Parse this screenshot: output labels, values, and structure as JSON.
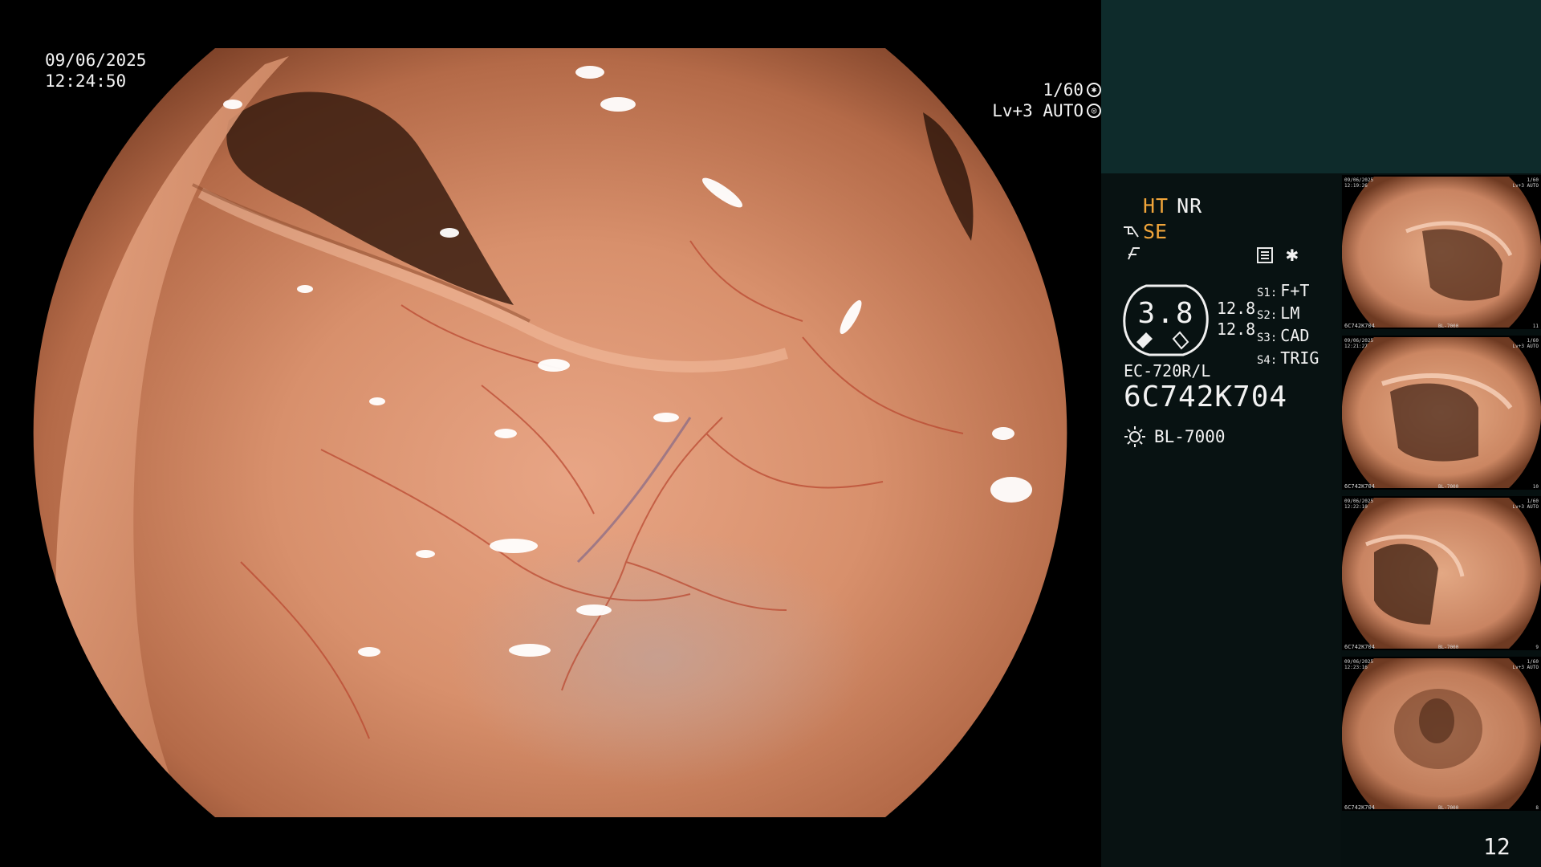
{
  "overlay": {
    "date": "09/06/2025",
    "time": "12:24:50",
    "shutter": "1/60",
    "level": "Lv+3 AUTO"
  },
  "panel": {
    "mode_ht": "HT",
    "mode_nr": "NR",
    "mode_se": "SE",
    "zoom": "3.8",
    "zoom_a": "12.8",
    "zoom_b": "12.8",
    "switches": [
      {
        "key": "S1:",
        "value": "F+T"
      },
      {
        "key": "S2:",
        "value": "LM"
      },
      {
        "key": "S3:",
        "value": "CAD"
      },
      {
        "key": "S4:",
        "value": "TRIG"
      }
    ],
    "scope_model": "EC-720R/L",
    "scope_serial": "6C742K704",
    "light_source": "BL-7000",
    "colors": {
      "accent_orange": "#f1a53a",
      "panel_top": "#0e2b2b",
      "panel_bg": "#081212"
    },
    "icons": [
      "scope-angle-icon",
      "freeze-icon",
      "settings-icon",
      "star-icon",
      "light-source-icon",
      "shutter-icon",
      "auto-iris-icon"
    ]
  },
  "thumbnails": [
    {
      "date": "09/06/2025",
      "time": "12:19:26",
      "shutter": "1/60",
      "level": "Lv+3 AUTO",
      "serial": "6C742K704",
      "light": "BL-7000",
      "index": "11"
    },
    {
      "date": "09/06/2025",
      "time": "12:21:27",
      "shutter": "1/60",
      "level": "Lv+3 AUTO",
      "serial": "6C742K704",
      "light": "BL-7000",
      "index": "10"
    },
    {
      "date": "09/06/2025",
      "time": "12:22:10",
      "shutter": "1/60",
      "level": "Lv+3 AUTO",
      "serial": "6C742K704",
      "light": "BL-7000",
      "index": "9"
    },
    {
      "date": "09/06/2025",
      "time": "12:23:16",
      "shutter": "1/60",
      "level": "Lv+3 AUTO",
      "serial": "6C742K704",
      "light": "BL-7000",
      "index": "8"
    }
  ],
  "page_number": "12"
}
